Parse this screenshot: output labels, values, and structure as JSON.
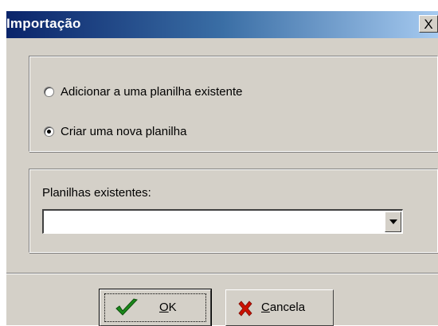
{
  "window": {
    "title": "Importação",
    "close_glyph": "X"
  },
  "options": {
    "items": [
      {
        "label": "Adicionar a uma planilha existente",
        "selected": false
      },
      {
        "label": "Criar uma nova planilha",
        "selected": true
      }
    ]
  },
  "existing": {
    "label": "Planilhas existentes:",
    "value": ""
  },
  "buttons": {
    "ok": {
      "mnemonic": "O",
      "rest": "K",
      "icon": "checkmark-icon"
    },
    "cancel": {
      "mnemonic": "C",
      "rest": "ancela",
      "icon": "x-icon"
    }
  },
  "colors": {
    "titlebar_start": "#0a246a",
    "titlebar_end": "#a6caf0",
    "face": "#d4d0c8",
    "ok_icon": "#1a8a1a",
    "cancel_icon": "#cc1100"
  }
}
